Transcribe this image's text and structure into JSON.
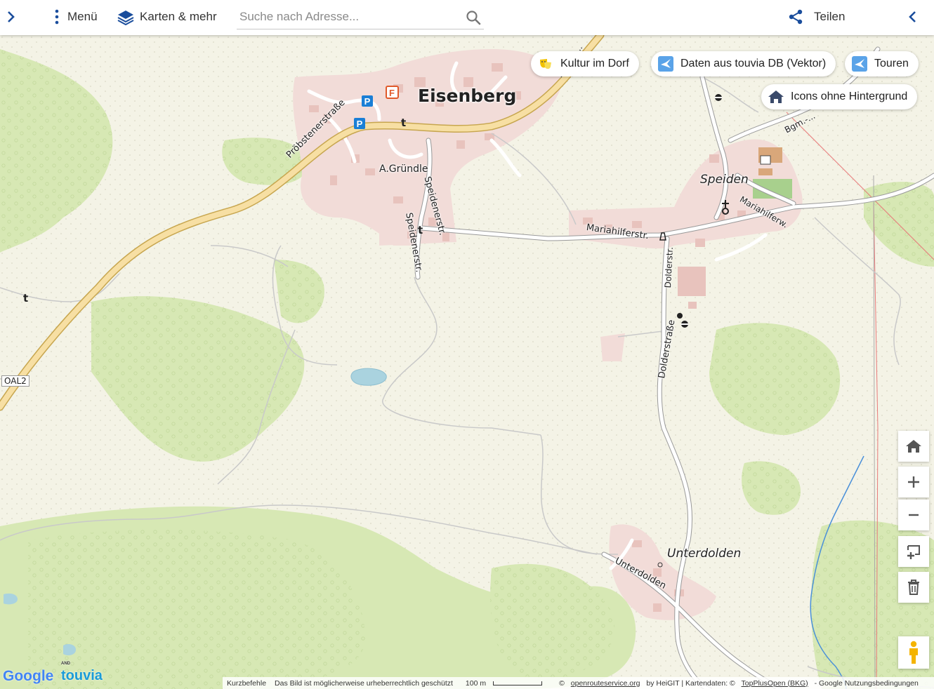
{
  "toolbar": {
    "menu_label": "Menü",
    "layers_label": "Karten & mehr",
    "search_placeholder": "Suche nach Adresse...",
    "share_label": "Teilen"
  },
  "chips": [
    {
      "label": "Kultur im Dorf",
      "icon": "theater-masks-icon"
    },
    {
      "label": "Daten aus touvia DB (Vektor)",
      "icon": "touvia-data-icon"
    },
    {
      "label": "Touren",
      "icon": "touvia-tour-icon"
    },
    {
      "label": "Icons ohne Hintergrund",
      "icon": "home-icon"
    }
  ],
  "map_labels": {
    "eisenberg": "Eisenberg",
    "speiden": "Speiden",
    "unterdolden_village": "Unterdolden",
    "probstenerstrasse": "Pröbstenerstraße",
    "a_grundle": "A.Gründle",
    "speidenerstr_1": "Speidenerstr.",
    "speidenerstr_2": "Speidenerstr.",
    "mariahilferstr": "Mariahilferstr.",
    "mariahilferw": "Mariahilferw.",
    "dolderstr": "Dolderstr.",
    "dolderstrasse": "Dolderstraße",
    "unterdolden_street": "Unterdolden",
    "oal2": "OAL2",
    "bgm": "Bgm.-...",
    "pfronten_top": "...nerst..."
  },
  "map_controls": [
    "home-icon",
    "zoom-in-icon",
    "zoom-out-icon",
    "add-feature-icon",
    "trash-icon",
    "pegman-icon"
  ],
  "logos": {
    "google": "Google",
    "touvia": "touvia",
    "touvia_sub": "AND"
  },
  "attribution": {
    "shortcuts": "Kurzbefehle",
    "copyright_note": "Das Bild ist möglicherweise urheberrechtlich geschützt",
    "scale": "100 m",
    "ors_prefix": "©",
    "ors_link": "openrouteservice.org",
    "ors_suffix": "by HeiGIT | Kartendaten: ©",
    "topplus_link": "TopPlusOpen (BKG)",
    "terms": "- Google Nutzungsbedingungen"
  },
  "colors": {
    "background": "#f4f3e6",
    "forest": "#d7e8b4",
    "built_area": "#f2dcd8",
    "building": "#e8c3bd",
    "main_road": "#f5d99a",
    "parking": "#1a7fd6",
    "fuel": "#e05a2b",
    "water": "#aad3df",
    "stream": "#4a90d9",
    "powerline": "#e87a7a",
    "accent": "#1a4d9c"
  }
}
